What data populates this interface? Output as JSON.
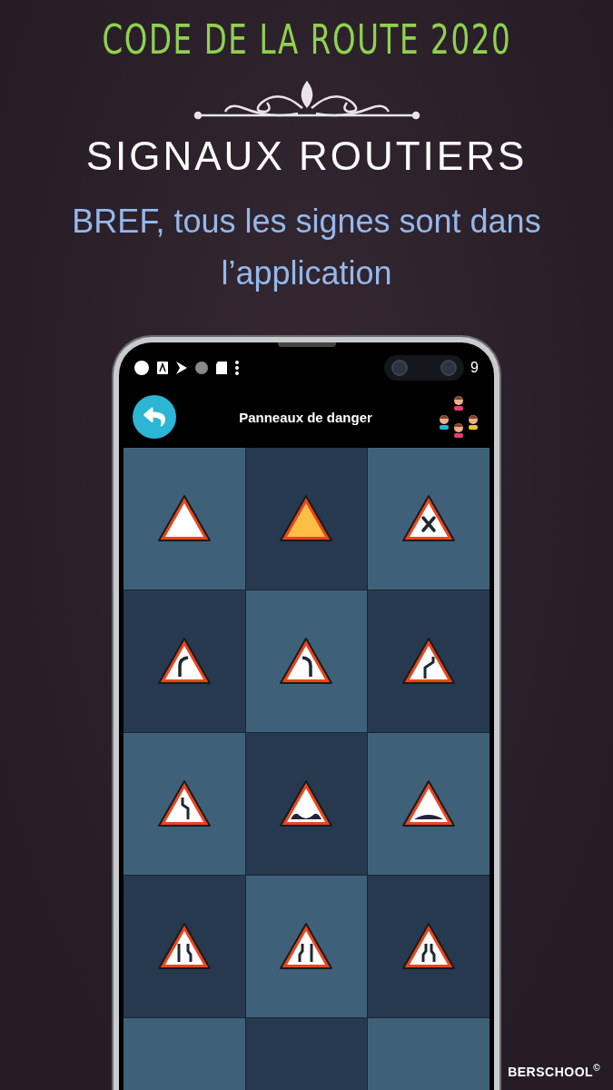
{
  "header": {
    "title": "CODE DE LA ROUTE 2020",
    "heading": "SIGNAUX ROUTIERS",
    "subtitle": "BREF, tous les signes sont dans l’application"
  },
  "phone": {
    "status_bar": {
      "time": "9"
    },
    "app_bar": {
      "title": "Panneaux de danger"
    },
    "signs": [
      {
        "kind": "plain"
      },
      {
        "kind": "yield"
      },
      {
        "kind": "crossroads"
      },
      {
        "kind": "curve-right"
      },
      {
        "kind": "curve-left"
      },
      {
        "kind": "double-curve"
      },
      {
        "kind": "double-curve-left"
      },
      {
        "kind": "bumps"
      },
      {
        "kind": "bump"
      },
      {
        "kind": "narrow-right"
      },
      {
        "kind": "narrow-left"
      },
      {
        "kind": "narrow-both"
      },
      {
        "kind": "empty"
      },
      {
        "kind": "empty"
      },
      {
        "kind": "empty"
      }
    ]
  },
  "brand": "BERSCHOOL$^{©}$"
}
